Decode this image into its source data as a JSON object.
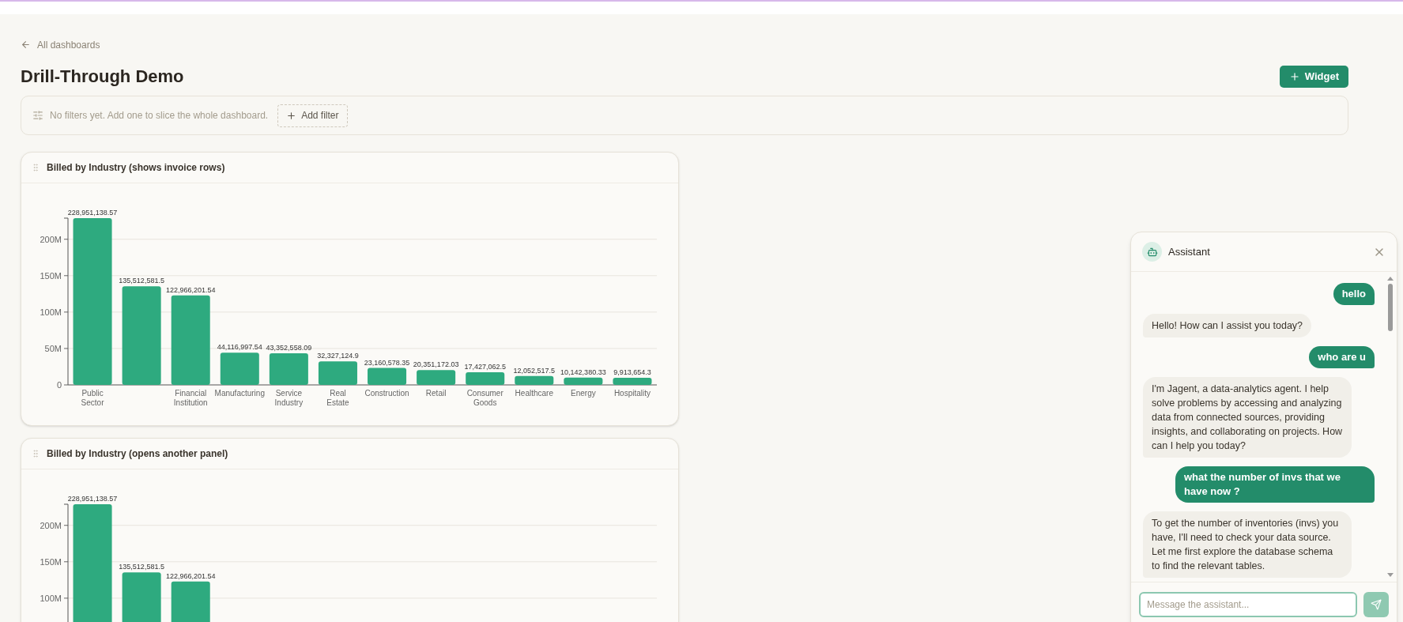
{
  "back_link": {
    "label": "All dashboards"
  },
  "title": "Drill-Through Demo",
  "add_widget_button": {
    "label": "Widget"
  },
  "filter_bar": {
    "message": "No filters yet. Add one to slice the whole dashboard.",
    "add_filter_button": "Add filter"
  },
  "widgets": [
    {
      "title": "Billed by Industry (shows invoice rows)",
      "chart_data": {
        "type": "bar",
        "categories": [
          "Public Sector",
          null,
          "Financial Institution",
          "Manufacturing",
          "Service Industry",
          "Real Estate",
          "Construction",
          "Retail",
          "Consumer Goods",
          "Healthcare",
          "Energy",
          "Hospitality"
        ],
        "grid": true,
        "series": [
          {
            "color": "#2eaa7f",
            "values": [
              229000000,
              135500000,
              123000000,
              44100000,
              43400000,
              32300000,
              23200000,
              20400000,
              17400000,
              12100000,
              10100000,
              9900000
            ]
          }
        ],
        "ylim": [
          0,
          229000000
        ],
        "yticks": [
          {
            "value": 0,
            "label": "0"
          },
          {
            "value": 50000000,
            "label": "50M"
          },
          {
            "value": 100000000,
            "label": "100M"
          },
          {
            "value": 150000000,
            "label": "150M"
          },
          {
            "value": 200000000,
            "label": "200M"
          }
        ],
        "value_labels": [
          "228,951,138.57",
          "135,512,581.5",
          "122,966,201.54",
          "44,116,997.54",
          "43,352,558.09",
          "32,327,124.9",
          "23,160,578.35",
          "20,351,172.03",
          "17,427,062.5",
          "12,052,517.5",
          "10,142,380.33",
          "9,913,654.3"
        ]
      }
    },
    {
      "title": "Billed by Industry (opens another panel)",
      "chart_data": {
        "type": "bar",
        "grid": true,
        "series": [
          {
            "color": "#2eaa7f",
            "values": [
              229000000,
              135500000,
              123000000
            ]
          }
        ],
        "ylim": [
          0,
          229000000
        ],
        "yticks": [
          {
            "value": 100000000,
            "label": "100M"
          },
          {
            "value": 150000000,
            "label": "150M"
          },
          {
            "value": 200000000,
            "label": "200M"
          }
        ],
        "value_labels": [
          "228,951,138.57",
          "135,512,581.5",
          "122,966,201.54"
        ]
      }
    }
  ],
  "assistant": {
    "title": "Assistant",
    "messages": [
      {
        "kind": "user",
        "text": "hello"
      },
      {
        "kind": "assistant",
        "text": "Hello! How can I assist you today?"
      },
      {
        "kind": "user",
        "text": "who are u"
      },
      {
        "kind": "assistant",
        "text": "I'm Jagent, a data-analytics agent. I help solve problems by accessing and analyzing data from connected sources, providing insights, and collaborating on projects. How can I help you today?"
      },
      {
        "kind": "user",
        "text": "what the number of invs that we have now ?"
      },
      {
        "kind": "assistant",
        "text": "To get the number of inventories (invs) you have, I'll need to check your data source. Let me first explore the database schema to find the relevant tables."
      }
    ],
    "input": {
      "placeholder": "Message the assistant..."
    }
  }
}
